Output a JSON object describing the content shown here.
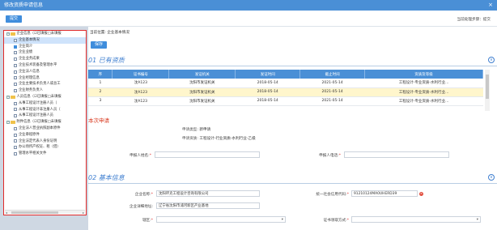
{
  "window": {
    "title": "修改资质申请信息",
    "close": "×"
  },
  "toolbar": {
    "submit_label": "提交",
    "current_step": "当前处理步骤：提交"
  },
  "tree": {
    "groups": [
      {
        "label": "企业信息（☑已填报□未填报",
        "items": [
          {
            "label": "企业基本情况",
            "checked": false,
            "selected": true
          },
          {
            "label": "企业简介",
            "checked": true,
            "selected": false
          },
          {
            "label": "企业业绩",
            "checked": false,
            "selected": false
          },
          {
            "label": "企业业务成果",
            "checked": false,
            "selected": false
          },
          {
            "label": "企业技术装备及管理水平",
            "checked": false,
            "selected": false
          },
          {
            "label": "企业法人信息",
            "checked": false,
            "selected": false
          },
          {
            "label": "企业经理信息",
            "checked": false,
            "selected": false
          },
          {
            "label": "企业主要技术负责人或总工",
            "checked": false,
            "selected": false
          },
          {
            "label": "企业财务负责人",
            "checked": false,
            "selected": false
          }
        ]
      },
      {
        "label": "人员信息（☑已填报□未填报",
        "items": [
          {
            "label": "从事工程设计注册人员（",
            "checked": false,
            "selected": false
          },
          {
            "label": "从事工程设计非注册人员（",
            "checked": false,
            "selected": false
          },
          {
            "label": "从事工程设计注册人员",
            "checked": false,
            "selected": false
          }
        ]
      },
      {
        "label": "附件信息（☑已填报□未填报",
        "items": [
          {
            "label": "企业法人营业执照副本原件",
            "checked": false,
            "selected": false
          },
          {
            "label": "企业章程原件",
            "checked": false,
            "selected": false
          },
          {
            "label": "企业法定代表人身份证明",
            "checked": false,
            "selected": false
          },
          {
            "label": "办公场所产权证、租（借）",
            "checked": false,
            "selected": false
          },
          {
            "label": "管理水平相关文件",
            "checked": false,
            "selected": false
          }
        ]
      }
    ],
    "scroll_left": "◂",
    "scroll_right": "▸"
  },
  "main": {
    "crumb": "当前位置: 企业基本情况",
    "save_label": "保存",
    "section1": {
      "num": "01",
      "title": "已有资质",
      "toggle": "∧"
    },
    "table": {
      "headers": [
        "序",
        "证书编号",
        "发证机关",
        "发证时间",
        "截止时间",
        "资质及等级"
      ],
      "rows": [
        [
          "1",
          "沈A123",
          "沈阳市发证机关",
          "2018-05-14",
          "2021-05-14",
          "工程设计-专业资质-水利行业..."
        ],
        [
          "2",
          "沈A123",
          "沈阳市发证机关",
          "2018-05-14",
          "2021-05-14",
          "工程设计-专业资质-水利行业..."
        ],
        [
          "3",
          "沈A123",
          "沈阳市发证机关",
          "2018-05-14",
          "2021-05-14",
          "工程设计-专业资质-水利行业..."
        ]
      ],
      "highlight_row": 1
    },
    "apply": {
      "title": "本次申请",
      "type_label": "申请类型:",
      "type_value": "新申请",
      "qual_label": "申请资质:",
      "qual_value": "工程设计-行业资质-水利行业-乙级",
      "applicant_label": "申报人姓名:",
      "applicant_req": "*",
      "phone_label": "申报人电话:",
      "phone_req": "*"
    },
    "section2": {
      "num": "02",
      "title": "基本信息",
      "toggle": "∨"
    },
    "basic": {
      "company_label": "企业名称:",
      "company_req": "*",
      "company_value": "沈阳环克工程设计咨询有限公司",
      "credit_label": "统一社会信用代码:",
      "credit_req": "*",
      "credit_value": "91210124MA0UHERD39",
      "credit_badge": "✕",
      "address_label": "企业详细地址:",
      "address_value": "辽宁省沈阳市浦河新区产业基地",
      "region_label": "辖区:",
      "region_req": "*",
      "cert_label": "证书领取方式:",
      "cert_req": "*"
    }
  }
}
